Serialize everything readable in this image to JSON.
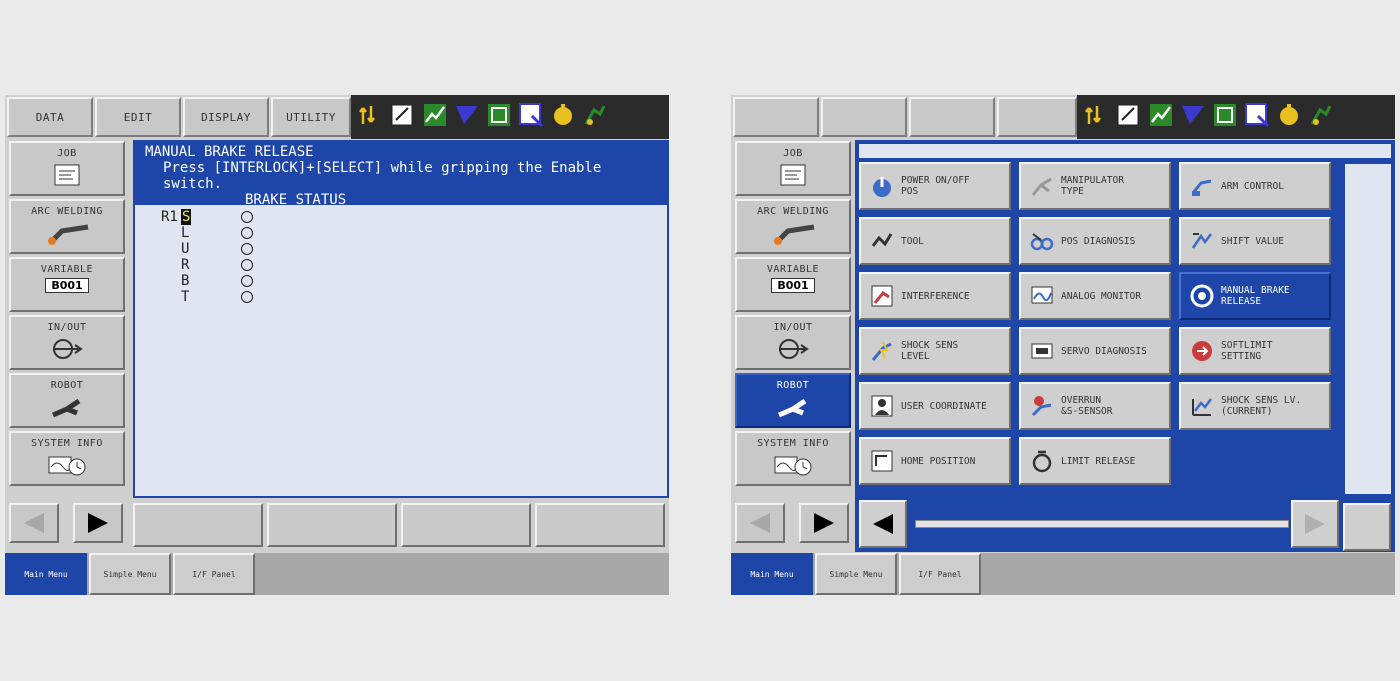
{
  "left": {
    "menu": [
      "DATA",
      "EDIT",
      "DISPLAY",
      "UTILITY"
    ],
    "content": {
      "title": "MANUAL BRAKE RELEASE",
      "instruction": "Press [INTERLOCK]+[SELECT] while gripping the Enable switch.",
      "column_header": "BRAKE STATUS",
      "robot": "R1",
      "axes": [
        "S",
        "L",
        "U",
        "R",
        "B",
        "T"
      ]
    }
  },
  "sidebar": {
    "job": "JOB",
    "arc_welding": "ARC WELDING",
    "variable": "VARIABLE",
    "variable_value": "B001",
    "in_out": "IN/OUT",
    "robot": "ROBOT",
    "system_info": "SYSTEM INFO"
  },
  "bottom_tabs": [
    "Main Menu",
    "Simple Menu",
    "I/F Panel"
  ],
  "right": {
    "tiles": [
      "POWER ON/OFF\nPOS",
      "MANIPULATOR\nTYPE",
      "ARM CONTROL",
      "TOOL",
      "POS DIAGNOSIS",
      "SHIFT VALUE",
      "INTERFERENCE",
      "ANALOG MONITOR",
      "MANUAL BRAKE\nRELEASE",
      "SHOCK SENS\nLEVEL",
      "SERVO DIAGNOSIS",
      "SOFTLIMIT\nSETTING",
      "USER COORDINATE",
      "OVERRUN\n&S-SENSOR",
      "SHOCK SENS LV.\n(CURRENT)",
      "HOME POSITION",
      "LIMIT RELEASE"
    ],
    "selected_tile": "MANUAL BRAKE\nRELEASE"
  },
  "colors": {
    "accent": "#1d46a8",
    "panel": "#cfcfcf",
    "content_bg": "#dfe6f2"
  }
}
